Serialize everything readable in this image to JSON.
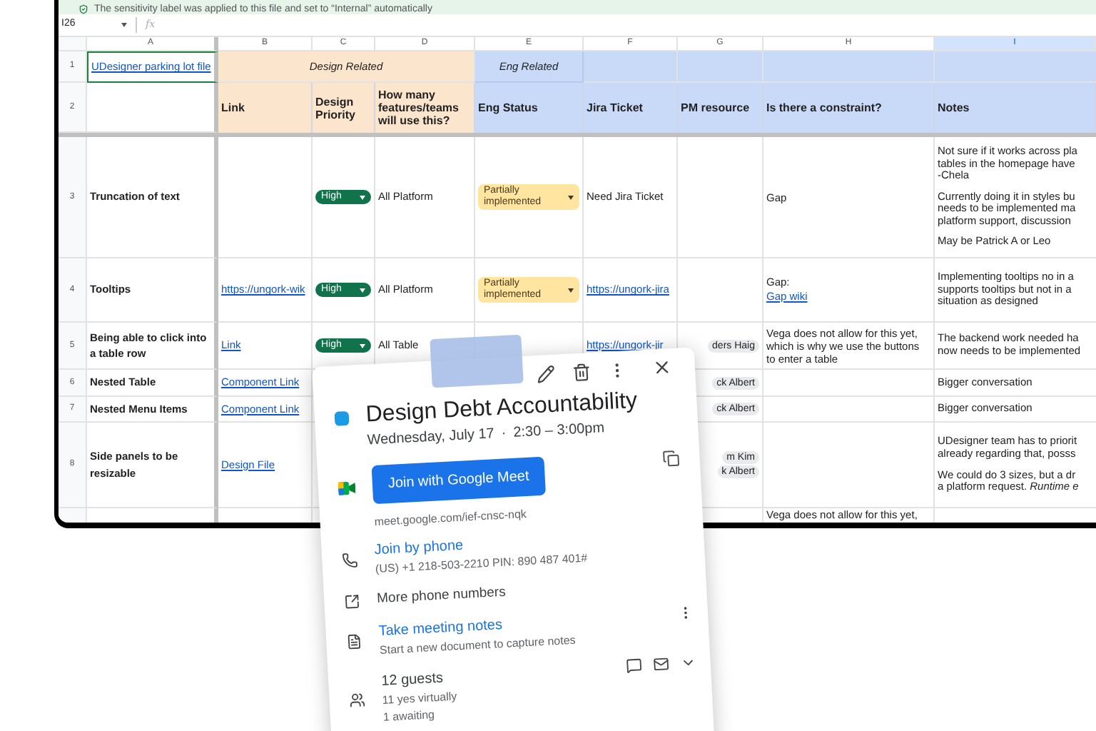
{
  "banner": {
    "text": "The sensitivity label was applied to this file and set to “Internal” automatically"
  },
  "formula_bar": {
    "cell_ref": "I26",
    "fx": "fx"
  },
  "sheet": {
    "columns": [
      {
        "label": "A",
        "selected": false
      },
      {
        "label": "B",
        "selected": false
      },
      {
        "label": "C",
        "selected": false
      },
      {
        "label": "D",
        "selected": false
      },
      {
        "label": "E",
        "selected": false
      },
      {
        "label": "F",
        "selected": false
      },
      {
        "label": "G",
        "selected": false
      },
      {
        "label": "H",
        "selected": false
      },
      {
        "label": "I",
        "selected": true
      }
    ],
    "group_row": {
      "number": "1",
      "link": "UDesigner parking lot file",
      "design_group": "Design Related",
      "eng_group": "Eng Related"
    },
    "header_row": {
      "number": "2",
      "headers": [
        "Link",
        "Design Priority",
        "How many features/teams will use this?",
        "Eng Status",
        "Jira Ticket",
        "PM resource",
        "Is there a constraint?",
        "Notes"
      ]
    },
    "rows": [
      {
        "number": "3",
        "feature": "Truncation of text",
        "priority": "High",
        "reach": "All Platform",
        "status": "Partially implemented",
        "jira": {
          "text": "Need Jira Ticket",
          "kind": "text"
        },
        "pm": [],
        "constraint": [
          {
            "text": "Gap",
            "kind": "text"
          }
        ],
        "notes": [
          [
            "Not sure if it works across pla",
            "tables in the homepage have",
            "-Chela"
          ],
          [
            "Currently doing it in styles bu",
            "needs to be implemented ma",
            "platform support, discussion"
          ],
          [
            "May be Patrick A or Leo"
          ]
        ]
      },
      {
        "number": "4",
        "feature": "Tooltips",
        "link": "https://ungork-wik",
        "priority": "High",
        "reach": "All Platform",
        "status": "Partially implemented",
        "jira": {
          "text": "https://ungork-jira",
          "kind": "link"
        },
        "pm": [],
        "constraint": [
          {
            "text": "Gap:",
            "kind": "text"
          },
          {
            "text": "Gap wiki",
            "kind": "link"
          }
        ],
        "notes": [
          [
            "Implementing tooltips no in a",
            "supports tooltips but not in a",
            "situation as designed"
          ]
        ]
      },
      {
        "number": "5",
        "feature": "Being able to click into a table row",
        "link": "Link",
        "priority": "High",
        "reach": "All Table",
        "jira": {
          "text": "https://ungork-jir",
          "kind": "link"
        },
        "pm": [
          "ders Haig"
        ],
        "constraint": [
          {
            "text": "Vega does not allow for this yet, which is why we use the buttons to enter a table",
            "kind": "text"
          }
        ],
        "notes": [
          [
            "The backend work needed ha",
            "now needs to be implemented"
          ]
        ]
      },
      {
        "number": "6",
        "feature": "Nested Table",
        "link": "Component Link",
        "pm": [
          "ck Albert"
        ],
        "constraint": [],
        "notes": [
          [
            "Bigger conversation"
          ]
        ]
      },
      {
        "number": "7",
        "feature": "Nested Menu Items",
        "link": "Component Link",
        "pm": [
          "ck Albert"
        ],
        "constraint": [],
        "notes": [
          [
            "Bigger conversation"
          ]
        ]
      },
      {
        "number": "8",
        "feature": "Side panels to be resizable",
        "link": "Design File",
        "pm": [
          "m Kim",
          "k Albert"
        ],
        "constraint": [],
        "notes": [
          [
            "UDesigner team has to priorit",
            "already regarding that, posss"
          ],
          [
            "We could do 3 sizes, but a dr",
            "a platform request. *Runtime e*"
          ]
        ]
      },
      {
        "pm": [],
        "constraint": [
          {
            "text": "Vega does not allow for this yet,",
            "kind": "text"
          }
        ],
        "notes": []
      }
    ]
  },
  "event": {
    "title": "Design Debt Accountability",
    "date": "Wednesday, July 17",
    "time": "2:30 – 3:00pm",
    "separator": "·",
    "join_button": "Join with Google Meet",
    "meet_link": "meet.google.com/ief-cnsc-nqk",
    "phone_title": "Join by phone",
    "phone_detail": "(US) +1 218-503-2210 PIN: 890 487 401#",
    "more_numbers": "More phone numbers",
    "notes_title": "Take meeting notes",
    "notes_detail": "Start a new document to capture notes",
    "guests_title": "12 guests",
    "guest_lines": [
      "11 yes virtually",
      "1 awaiting"
    ],
    "color": "#1a9be6"
  }
}
